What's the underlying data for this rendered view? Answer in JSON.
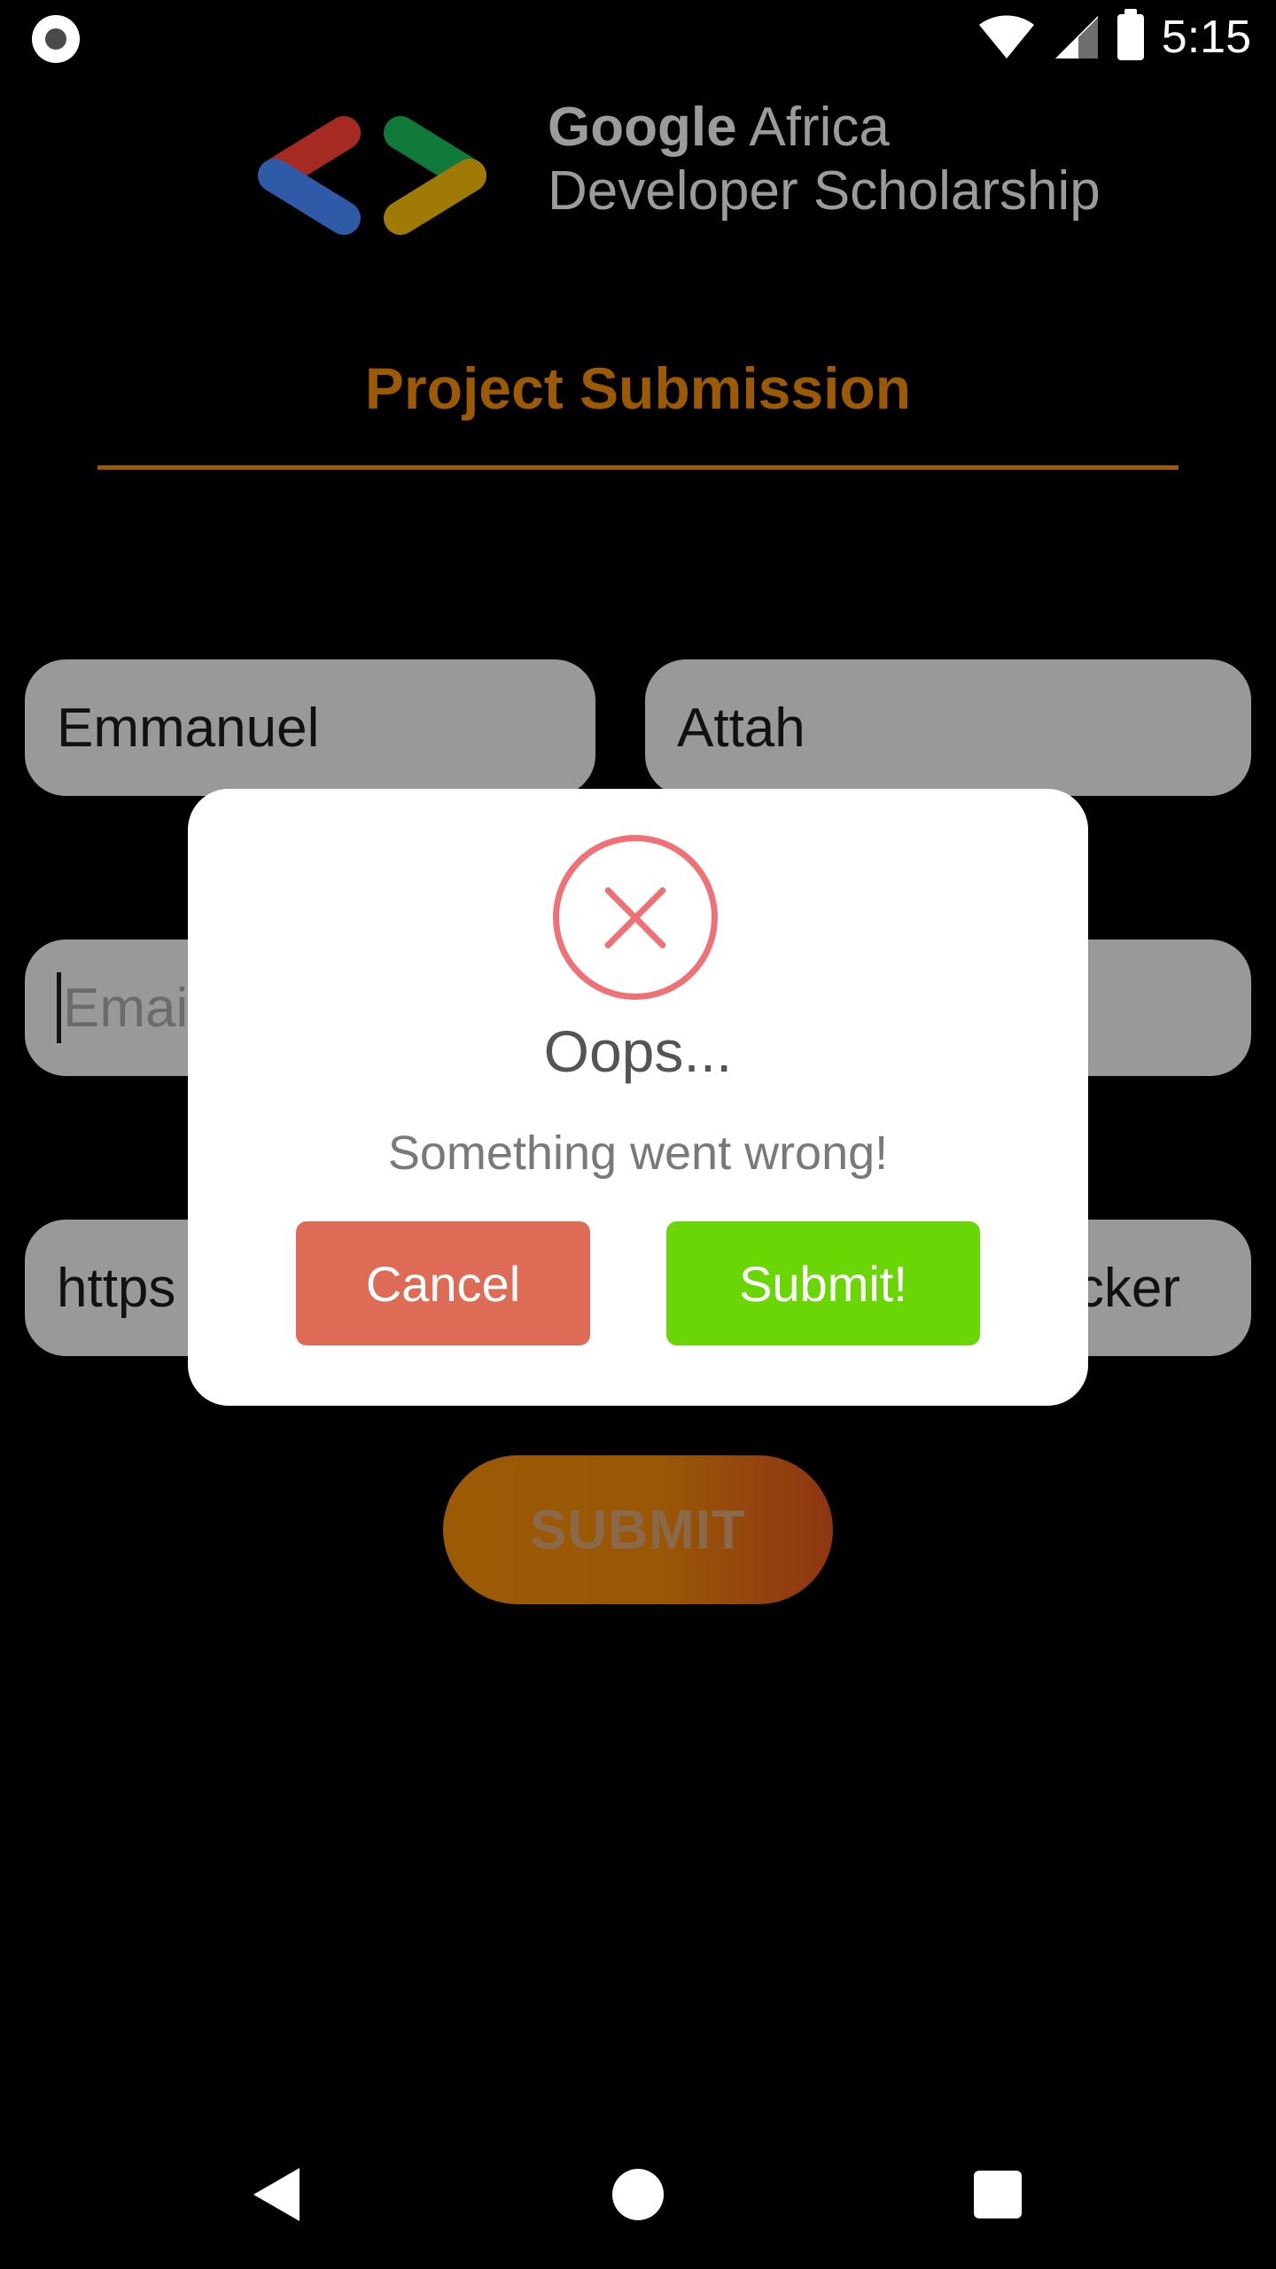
{
  "status_bar": {
    "time": "5:15",
    "icons": [
      "record-indicator-icon",
      "wifi-icon",
      "signal-icon",
      "battery-icon"
    ]
  },
  "header": {
    "logo_line1_bold": "Google",
    "logo_line1_rest": "Africa",
    "logo_line2": "Developer Scholarship",
    "logo_colors": {
      "red": "#a52a22",
      "blue": "#2f5aa8",
      "green": "#0f7a3a",
      "yellow": "#a07a06"
    }
  },
  "page": {
    "title": "Project Submission",
    "accent_color": "#9c5a05"
  },
  "form": {
    "first_name": "Emmanuel",
    "last_name": "Attah",
    "email_placeholder": "Email",
    "link_value_left": "https",
    "link_value_right": "cker",
    "submit_label": "SUBMIT"
  },
  "dialog": {
    "icon": "error-x-icon",
    "title": "Oops...",
    "message": "Something went wrong!",
    "cancel_label": "Cancel",
    "confirm_label": "Submit!",
    "cancel_color": "#dd6b55",
    "confirm_color": "#6bd605"
  },
  "nav_bar": {
    "icons": [
      "back-icon",
      "home-icon",
      "recents-icon"
    ]
  }
}
